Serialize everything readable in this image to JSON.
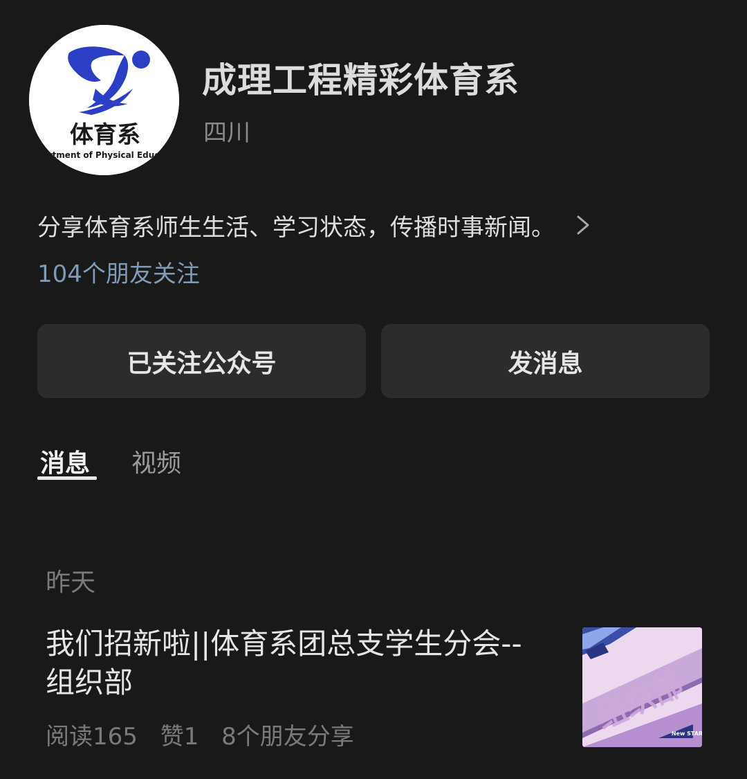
{
  "account": {
    "name": "成理工程精彩体育系",
    "region": "四川",
    "logo_text": "体育系",
    "logo_subtext": "Department of Physical Education"
  },
  "bio": {
    "text": "分享体育系师生生活、学习状态，传播时事新闻。",
    "followers": "104个朋友关注"
  },
  "buttons": {
    "follow_label": "已关注公众号",
    "message_label": "发消息"
  },
  "tabs": [
    {
      "label": "消息",
      "active": true
    },
    {
      "label": "视频",
      "active": false
    }
  ],
  "feed": {
    "date_label": "昨天",
    "article": {
      "title": "我们招新啦||体育系团总支学生分会--组织部",
      "reads": "阅读165",
      "likes": "赞1",
      "shares": "8个朋友分享",
      "thumb_text": "组织部",
      "thumb_badge": "New START"
    }
  },
  "colors": {
    "background": "#191919",
    "button_bg": "#2c2c2c",
    "followers_link": "#7f9bb8",
    "logo_blue": "#2c3fc4"
  },
  "icons": {
    "bio_expand": "chevron-right-icon"
  }
}
